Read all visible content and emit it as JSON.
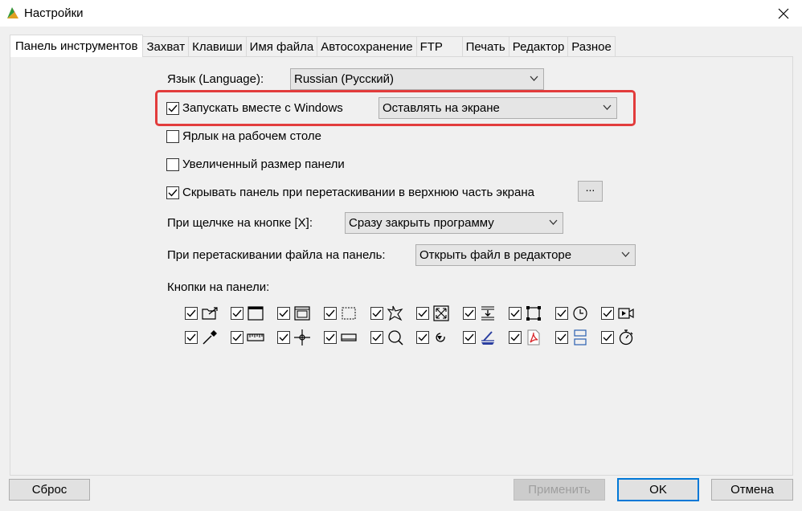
{
  "window": {
    "title": "Настройки"
  },
  "tabs": [
    {
      "label": "Панель инструментов",
      "active": true
    },
    {
      "label": "Захват"
    },
    {
      "label": "Клавиши"
    },
    {
      "label": "Имя файла"
    },
    {
      "label": "Автосохранение"
    },
    {
      "label": "FTP"
    },
    {
      "label": "Печать"
    },
    {
      "label": "Редактор"
    },
    {
      "label": "Разное"
    }
  ],
  "language": {
    "label": "Язык (Language):",
    "value": "Russian (Русский)"
  },
  "startup": {
    "label": "Запускать вместе с Windows",
    "checked": true,
    "mode_value": "Оставлять на экране"
  },
  "desktop_shortcut": {
    "label": "Ярлык на рабочем столе",
    "checked": false
  },
  "large_panel": {
    "label": "Увеличенный размер панели",
    "checked": false
  },
  "hide_panel": {
    "label": "Скрывать панель при перетаскивании в верхнюю часть экрана",
    "checked": true,
    "button_label": "..."
  },
  "close_click": {
    "label": "При щелчке на кнопке [X]:",
    "value": "Сразу закрыть программу"
  },
  "drag_file": {
    "label": "При перетаскивании файла на панель:",
    "value": "Открыть файл в редакторе"
  },
  "panel_buttons": {
    "label": "Кнопки на панели:",
    "row1": [
      "open-folder-icon",
      "window-icon",
      "window-scroll-icon",
      "region-dotted-icon",
      "freeform-star-icon",
      "fullscreen-icon",
      "scroll-capture-icon",
      "object-icon",
      "timer-clock-icon",
      "video-icon"
    ],
    "row2": [
      "eyedropper-icon",
      "ruler-icon",
      "crosshair-icon",
      "whiteboard-icon",
      "magnifier-icon",
      "repeat-icon",
      "scanner-icon",
      "pdf-icon",
      "split-window-icon",
      "stopwatch-icon"
    ]
  },
  "footer": {
    "reset": "Сброс",
    "apply": "Применить",
    "ok": "OK",
    "cancel": "Отмена"
  },
  "colors": {
    "highlight": "#e23c3c",
    "default_button": "#0078d7"
  }
}
